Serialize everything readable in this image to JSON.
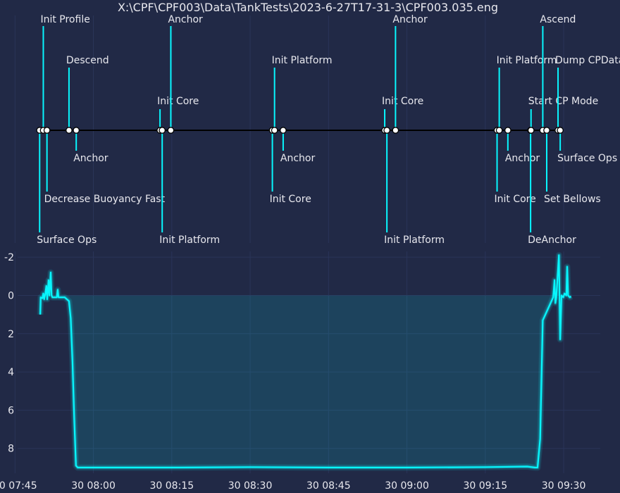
{
  "title": "X:\\CPF\\CPF003\\Data\\TankTests\\2023-6-27T17-31-3\\CPF003.035.eng",
  "colors": {
    "background": "#212946",
    "line": "#08F7FE",
    "fill": "#1f4a5e",
    "grid": "#2A3459",
    "timeline": "#000000",
    "text": "#e8e8ee"
  },
  "chart_data": [
    {
      "type": "timeline",
      "events": [
        {
          "label": "Surface Ops",
          "time": "07:49:43",
          "level": -3
        },
        {
          "label": "Init Profile",
          "time": "07:50:25",
          "level": 3
        },
        {
          "label": "Decrease Buoyancy Fast",
          "time": "07:51:07",
          "level": -2
        },
        {
          "label": "Descend",
          "time": "07:55:20",
          "level": 2
        },
        {
          "label": "Anchor",
          "time": "07:56:43",
          "level": -1
        },
        {
          "label": "Init Core",
          "time": "08:12:45",
          "level": 1
        },
        {
          "label": "Init Platform",
          "time": "08:13:10",
          "level": -3
        },
        {
          "label": "Anchor",
          "time": "08:14:49",
          "level": 3
        },
        {
          "label": "Init Core",
          "time": "08:34:15",
          "level": -2
        },
        {
          "label": "Init Platform",
          "time": "08:34:40",
          "level": 2
        },
        {
          "label": "Anchor",
          "time": "08:36:19",
          "level": -1
        },
        {
          "label": "Init Core",
          "time": "08:55:45",
          "level": 1
        },
        {
          "label": "Init Platform",
          "time": "08:56:10",
          "level": -3
        },
        {
          "label": "Anchor",
          "time": "08:57:49",
          "level": 3
        },
        {
          "label": "Init Core",
          "time": "09:17:15",
          "level": -2
        },
        {
          "label": "Init Platform",
          "time": "09:17:40",
          "level": 2
        },
        {
          "label": "Anchor",
          "time": "09:19:19",
          "level": -1
        },
        {
          "label": "DeAnchor",
          "time": "09:23:40",
          "level": -3
        },
        {
          "label": "Start CP Mode",
          "time": "09:23:45",
          "level": 1
        },
        {
          "label": "Ascend",
          "time": "09:26:00",
          "level": 3
        },
        {
          "label": "Set Bellows",
          "time": "09:26:45",
          "level": -2
        },
        {
          "label": "Dump CPData",
          "time": "09:28:55",
          "level": 2
        },
        {
          "label": "Surface Ops",
          "time": "09:29:20",
          "level": -1
        }
      ]
    },
    {
      "type": "area",
      "y_inverted": true,
      "ylim": [
        9.3,
        -2.3
      ],
      "yticks": [
        -2,
        0,
        2,
        4,
        6,
        8
      ],
      "xlim": [
        "07:45:30",
        "09:37:00"
      ],
      "xticks": [
        "07:45",
        "08:00",
        "08:15",
        "08:30",
        "08:45",
        "09:00",
        "09:15",
        "09:30"
      ],
      "xtick_labels": [
        "30 07:45",
        "30 08:00",
        "30 08:15",
        "30 08:30",
        "30 08:45",
        "30 09:00",
        "30 09:15",
        "30 09:30"
      ],
      "grid": true,
      "series": [
        {
          "points": [
            [
              "07:49:50",
              1.0
            ],
            [
              "07:49:55",
              0.1
            ],
            [
              "07:50:15",
              0.15
            ],
            [
              "07:50:25",
              -0.1
            ],
            [
              "07:50:35",
              0.2
            ],
            [
              "07:50:45",
              0.0
            ],
            [
              "07:51:00",
              -0.5
            ],
            [
              "07:51:10",
              0.2
            ],
            [
              "07:51:25",
              -0.8
            ],
            [
              "07:51:35",
              0.0
            ],
            [
              "07:51:50",
              -1.2
            ],
            [
              "07:52:00",
              0.0
            ],
            [
              "07:52:10",
              0.1
            ],
            [
              "07:53:00",
              0.1
            ],
            [
              "07:53:10",
              -0.3
            ],
            [
              "07:53:20",
              0.1
            ],
            [
              "07:54:30",
              0.1
            ],
            [
              "07:55:20",
              0.3
            ],
            [
              "07:55:40",
              1.2
            ],
            [
              "07:56:00",
              3.5
            ],
            [
              "07:56:20",
              6.5
            ],
            [
              "07:56:40",
              8.9
            ],
            [
              "07:57:00",
              9.0
            ],
            [
              "08:15:00",
              9.0
            ],
            [
              "08:30:00",
              8.98
            ],
            [
              "08:45:00",
              9.0
            ],
            [
              "09:00:00",
              9.0
            ],
            [
              "09:15:00",
              8.98
            ],
            [
              "09:23:00",
              8.95
            ],
            [
              "09:24:30",
              9.0
            ],
            [
              "09:25:00",
              9.0
            ],
            [
              "09:25:30",
              7.5
            ],
            [
              "09:26:00",
              1.3
            ],
            [
              "09:28:00",
              0.1
            ],
            [
              "09:28:15",
              -0.8
            ],
            [
              "09:28:25",
              0.4
            ],
            [
              "09:28:35",
              0.1
            ],
            [
              "09:29:05",
              -2.1
            ],
            [
              "09:29:20",
              2.3
            ],
            [
              "09:29:35",
              0.0
            ],
            [
              "09:29:55",
              0.1
            ],
            [
              "09:30:10",
              -0.1
            ],
            [
              "09:30:30",
              0.0
            ],
            [
              "09:30:40",
              -1.5
            ],
            [
              "09:30:50",
              0.0
            ],
            [
              "09:31:10",
              0.1
            ],
            [
              "09:31:25",
              0.05
            ]
          ]
        }
      ]
    }
  ]
}
